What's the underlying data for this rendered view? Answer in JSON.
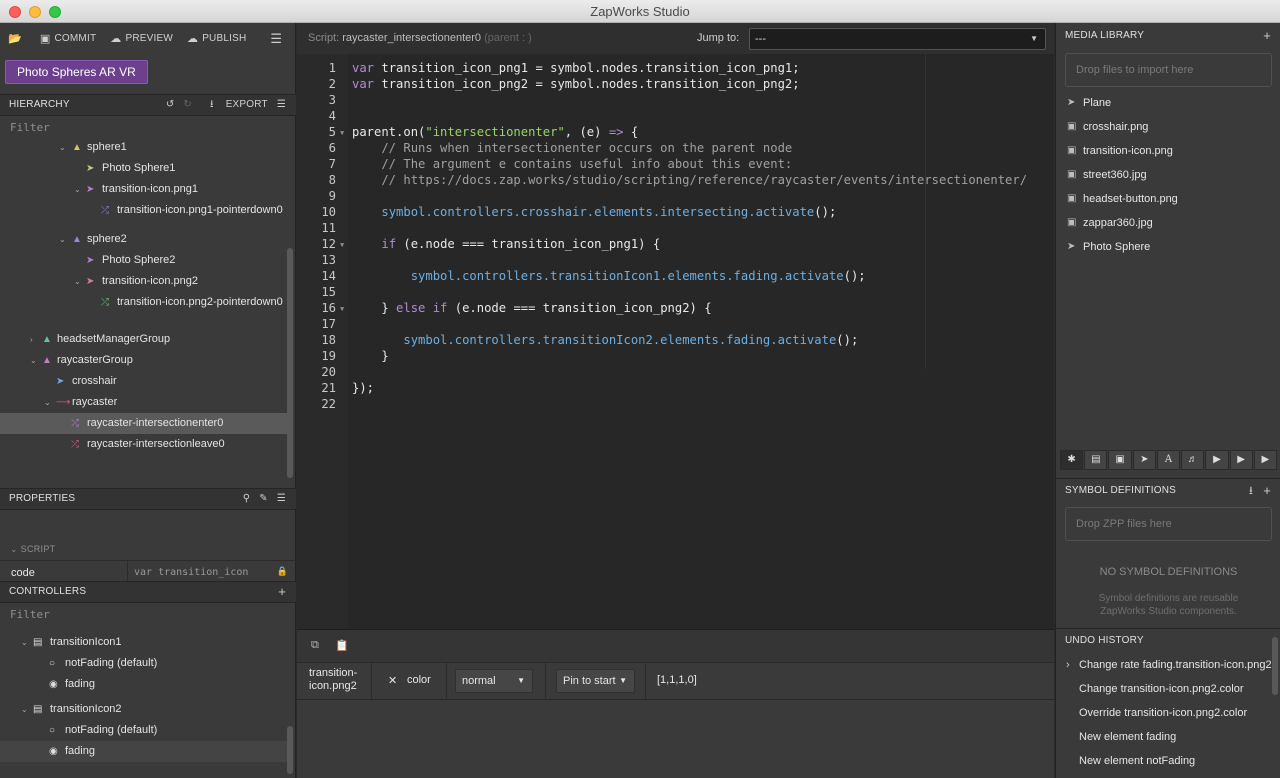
{
  "window": {
    "title": "ZapWorks Studio"
  },
  "toolbar": {
    "commit": "COMMIT",
    "preview": "PREVIEW",
    "publish": "PUBLISH"
  },
  "project": {
    "name": "Photo Spheres AR VR"
  },
  "hierarchy": {
    "title": "HIERARCHY",
    "export": "EXPORT",
    "filter": "Filter",
    "nodes": [
      {
        "label": "sphere1"
      },
      {
        "label": "Photo Sphere1"
      },
      {
        "label": "transition-icon.png1"
      },
      {
        "label": "transition-icon.png1-pointerdown0"
      },
      {
        "label": "sphere2"
      },
      {
        "label": "Photo Sphere2"
      },
      {
        "label": "transition-icon.png2"
      },
      {
        "label": "transition-icon.png2-pointerdown0"
      },
      {
        "label": "headsetManagerGroup"
      },
      {
        "label": "raycasterGroup"
      },
      {
        "label": "crosshair"
      },
      {
        "label": "raycaster"
      },
      {
        "label": "raycaster-intersectionenter0"
      },
      {
        "label": "raycaster-intersectionleave0"
      }
    ]
  },
  "properties": {
    "title": "PROPERTIES",
    "subsection": "SCRIPT",
    "key": "code",
    "value": "var transition_icon"
  },
  "controllers": {
    "title": "CONTROLLERS",
    "filter": "Filter",
    "items": [
      {
        "label": "transitionIcon1"
      },
      {
        "label": "notFading (default)"
      },
      {
        "label": "fading"
      },
      {
        "label": "transitionIcon2"
      },
      {
        "label": "notFading (default)"
      },
      {
        "label": "fading"
      }
    ]
  },
  "script": {
    "prefix": "Script:",
    "name": "raycaster_intersectionenter0",
    "parent": "(parent : )",
    "jump_label": "Jump to:",
    "jump_value": "---"
  },
  "editor": {
    "lines": [
      "1",
      "2",
      "3",
      "4",
      "5",
      "6",
      "7",
      "8",
      "9",
      "10",
      "11",
      "12",
      "13",
      "14",
      "15",
      "16",
      "17",
      "18",
      "19",
      "20",
      "21",
      "22"
    ]
  },
  "timeline": {
    "target": "transition-icon.png2",
    "property": "color",
    "blend": "normal",
    "pin": "Pin to start",
    "value": "[1,1,1,0]"
  },
  "media_library": {
    "title": "MEDIA LIBRARY",
    "dropzone": "Drop files to import here",
    "items": [
      {
        "label": "Plane"
      },
      {
        "label": "crosshair.png"
      },
      {
        "label": "transition-icon.png"
      },
      {
        "label": "street360.jpg"
      },
      {
        "label": "headset-button.png"
      },
      {
        "label": "zappar360.jpg"
      },
      {
        "label": "Photo Sphere"
      }
    ]
  },
  "symbol_definitions": {
    "title": "SYMBOL DEFINITIONS",
    "dropzone": "Drop ZPP files here",
    "empty_title": "NO SYMBOL DEFINITIONS",
    "empty_sub": "Symbol definitions are reusable ZapWorks Studio components."
  },
  "undo_history": {
    "title": "UNDO HISTORY",
    "items": [
      {
        "label": "Change rate fading.transition-icon.png2"
      },
      {
        "label": "Change transition-icon.png2.color"
      },
      {
        "label": "Override transition-icon.png2.color"
      },
      {
        "label": "New element fading"
      },
      {
        "label": "New element notFading"
      }
    ]
  }
}
